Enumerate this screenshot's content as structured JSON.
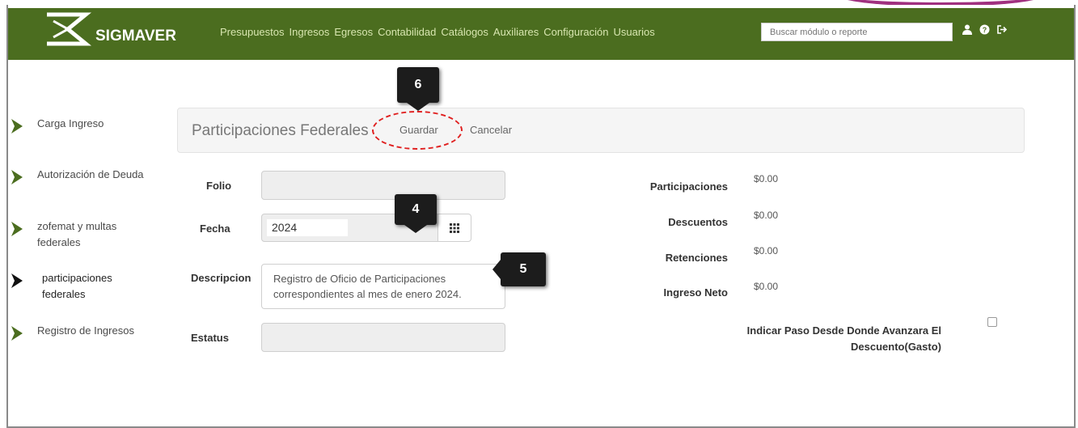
{
  "app": {
    "brand": "SIGMAVER"
  },
  "nav": {
    "links": [
      "Presupuestos",
      "Ingresos",
      "Egresos",
      "Contabilidad",
      "Catálogos",
      "Auxiliares",
      "Configuración",
      "Usuarios"
    ],
    "search_placeholder": "Buscar módulo o reporte",
    "icons": [
      "user-icon",
      "help-icon",
      "logout-icon"
    ]
  },
  "sidebar": {
    "items": [
      {
        "label": "Carga Ingreso"
      },
      {
        "label": "Autorización de Deuda"
      },
      {
        "label": "zofemat y multas federales"
      },
      {
        "label": "participaciones federales"
      },
      {
        "label": "Registro de Ingresos"
      }
    ]
  },
  "toolbar": {
    "title": "Participaciones Federales",
    "save_label": "Guardar",
    "cancel_label": "Cancelar"
  },
  "form": {
    "folio_label": "Folio",
    "folio_value": "",
    "fecha_label": "Fecha",
    "fecha_value": "2024",
    "descripcion_label": "Descripcion",
    "descripcion_value": "Registro de Oficio de Participaciones correspondientes al mes de enero 2024.",
    "estatus_label": "Estatus",
    "estatus_value": ""
  },
  "summary": {
    "participaciones_label": "Participaciones",
    "participaciones_value": "$0.00",
    "descuentos_label": "Descuentos",
    "descuentos_value": "$0.00",
    "retenciones_label": "Retenciones",
    "retenciones_value": "$0.00",
    "ingreso_neto_label": "Ingreso Neto",
    "ingreso_neto_value": "$0.00",
    "checkbox_label": "Indicar Paso Desde Donde Avanzara El Descuento(Gasto)",
    "checkbox_checked": false
  },
  "annotations": {
    "step_6": "6",
    "step_4": "4",
    "step_5": "5"
  },
  "colors": {
    "navbar": "#4b6d1f",
    "sidebar_arrow": "#4b6d1f",
    "highlight_circle": "#e02020"
  }
}
